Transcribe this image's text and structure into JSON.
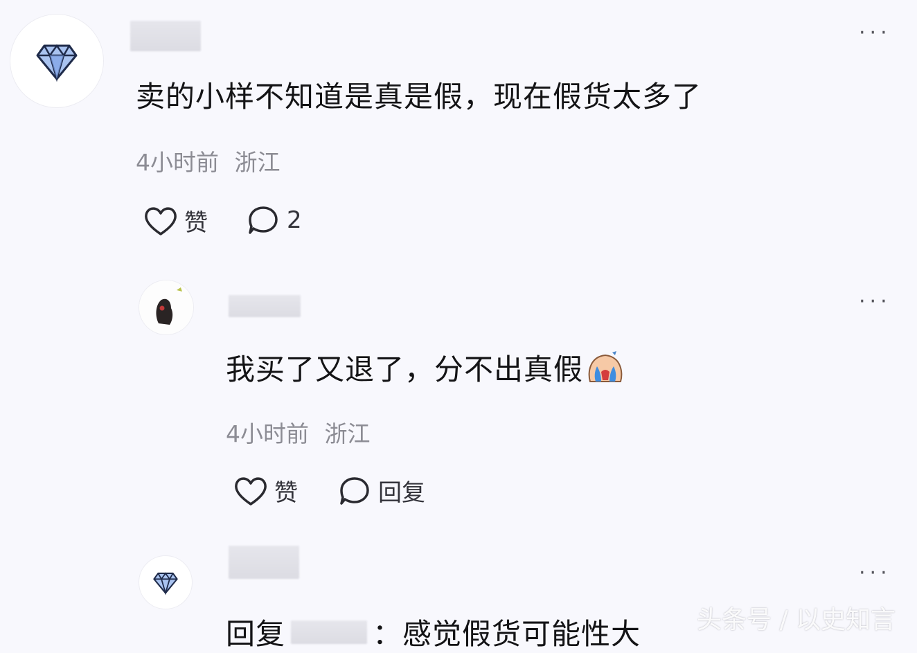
{
  "comments": [
    {
      "text": "卖的小样不知道是真是假，现在假货太多了",
      "time": "4小时前",
      "location": "浙江",
      "like_label": "赞",
      "reply_count": "2",
      "more_label": "···"
    },
    {
      "text": "我买了又退了，分不出真假",
      "time": "4小时前",
      "location": "浙江",
      "like_label": "赞",
      "reply_label": "回复",
      "more_label": "···"
    },
    {
      "text_prefix": "回复",
      "text": "：感觉假货可能性大",
      "more_label": "···"
    }
  ],
  "watermark": "头条号 / 以史知言",
  "colors": {
    "background": "#f8f8fd",
    "diamond": "#6a8ed6",
    "meta_text": "#8c8c94"
  }
}
